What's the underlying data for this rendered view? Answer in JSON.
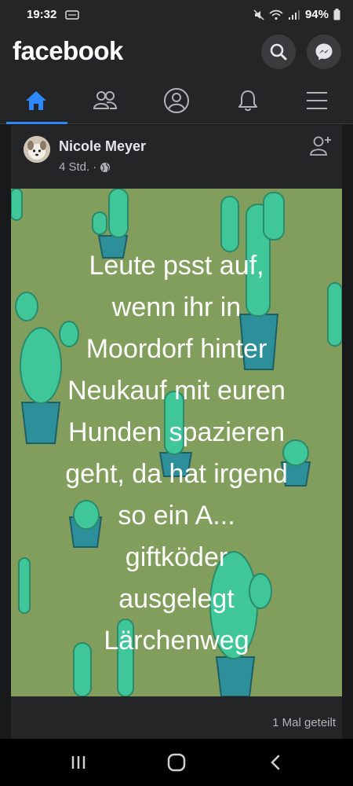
{
  "status_bar": {
    "time": "19:32",
    "battery": "94%",
    "icons": [
      "ctr-icon",
      "mute-icon",
      "wifi-icon",
      "signal-icon",
      "battery-icon"
    ]
  },
  "header": {
    "logo": "facebook",
    "search_icon": "search-icon",
    "messenger_icon": "messenger-icon"
  },
  "nav": {
    "tabs": [
      {
        "icon": "home-icon",
        "active": true
      },
      {
        "icon": "friends-icon",
        "active": false
      },
      {
        "icon": "profile-icon",
        "active": false
      },
      {
        "icon": "bell-icon",
        "active": false
      },
      {
        "icon": "menu-icon",
        "active": false
      }
    ]
  },
  "post": {
    "author": "Nicole Meyer",
    "time": "4 Std.",
    "separator": "·",
    "privacy_icon": "globe-icon",
    "text": "Leute psst auf,\nwenn ihr in\nMoordorf hinter\nNeukauf mit euren\nHunden spazieren\ngeht, da hat irgend\nso ein A...\ngiftköder\nausgelegt\nLärchenweg",
    "shares": "1 Mal geteilt"
  },
  "system_nav": {
    "icons": [
      "recent-apps-icon",
      "home-circle-icon",
      "back-icon"
    ]
  },
  "colors": {
    "accent": "#2d88ff",
    "background": "#18191a",
    "surface": "#242526",
    "post_bg": "#819e5c"
  }
}
